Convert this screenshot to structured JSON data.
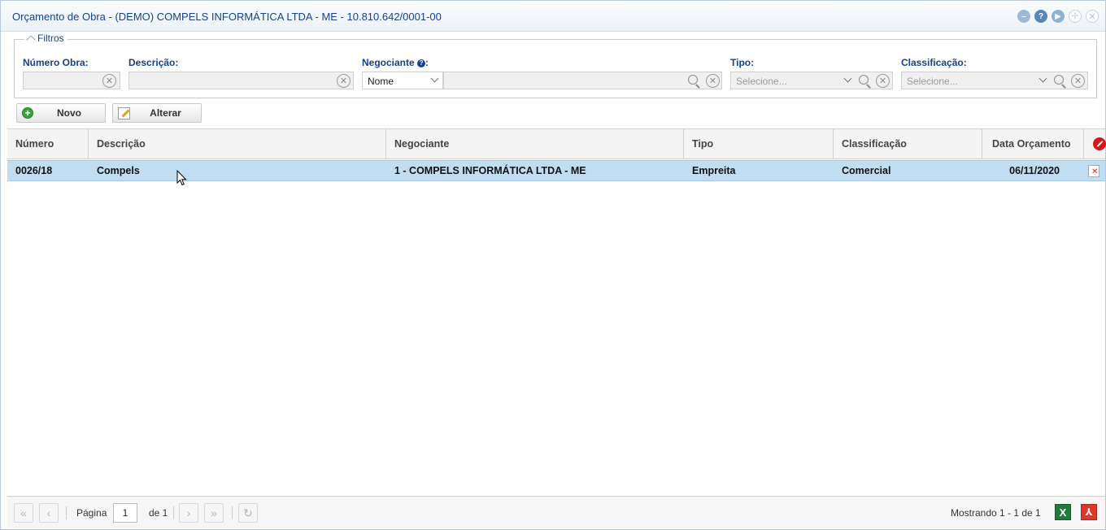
{
  "window": {
    "title": "Orçamento de Obra - (DEMO) COMPELS INFORMÁTICA LTDA - ME - 10.810.642/0001-00",
    "tools": [
      "minimize-icon",
      "help-icon",
      "next-icon",
      "maximize-icon",
      "close-icon"
    ]
  },
  "filters": {
    "legend": "Filtros",
    "numero_obra": {
      "label": "Número Obra:",
      "value": ""
    },
    "descricao": {
      "label": "Descrição:",
      "value": ""
    },
    "negociante": {
      "label": "Negociante",
      "label_suffix": ":",
      "mode": "Nome",
      "value": ""
    },
    "tipo": {
      "label": "Tipo:",
      "placeholder": "Selecione..."
    },
    "classificacao": {
      "label": "Classificação:",
      "placeholder": "Selecione..."
    }
  },
  "toolbar": {
    "novo_label": "Novo",
    "alterar_label": "Alterar"
  },
  "grid": {
    "columns": [
      "Número",
      "Descrição",
      "Negociante",
      "Tipo",
      "Classificação",
      "Data Orçamento"
    ],
    "rows": [
      {
        "numero": "0026/18",
        "descricao": "Compels",
        "negociante": "1 - COMPELS INFORMÁTICA LTDA - ME",
        "tipo": "Empreita",
        "classificacao": "Comercial",
        "data": "06/11/2020",
        "selected": true
      }
    ]
  },
  "paging": {
    "page_label": "Página",
    "page": "1",
    "of_label": "de 1",
    "display": "Mostrando 1 - 1 de 1"
  },
  "colors": {
    "title": "#15428b",
    "selected_row": "#c1ddf1",
    "excel": "#1e7b3a",
    "pdf": "#d93a2b"
  }
}
